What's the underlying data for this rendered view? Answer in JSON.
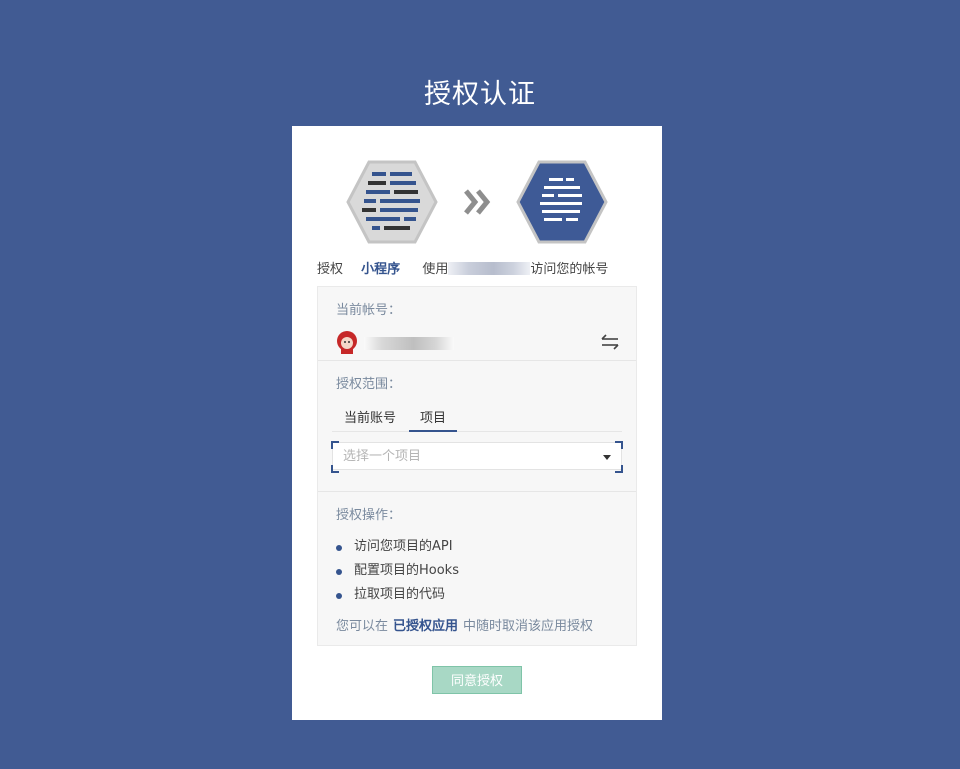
{
  "page": {
    "title": "授权认证"
  },
  "colors": {
    "background": "#415b93",
    "accent": "#35548e",
    "button_bg": "#a8d8c5"
  },
  "header_icons": {
    "app_icon": "mini-program-hex-icon",
    "arrow_icon": "double-chevron-right-icon",
    "target_icon": "platform-hex-icon"
  },
  "authorize_line": {
    "prefix": "授权",
    "app_name": "小程序",
    "use_text": "使用",
    "suffix": "访问您的帐号"
  },
  "current_account": {
    "label": "当前帐号：",
    "avatar_icon": "avatar-icon",
    "switch_icon": "switch-account-icon"
  },
  "scope": {
    "label": "授权范围：",
    "tabs": [
      {
        "label": "当前账号",
        "active": false
      },
      {
        "label": "项目",
        "active": true
      }
    ],
    "select_placeholder": "选择一个项目"
  },
  "operations": {
    "label": "授权操作：",
    "items": [
      "访问您项目的API",
      "配置项目的Hooks",
      "拉取项目的代码"
    ]
  },
  "note": {
    "before": "您可以在",
    "link": "已授权应用",
    "after": "中随时取消该应用授权"
  },
  "agree_button": {
    "label": "同意授权"
  }
}
